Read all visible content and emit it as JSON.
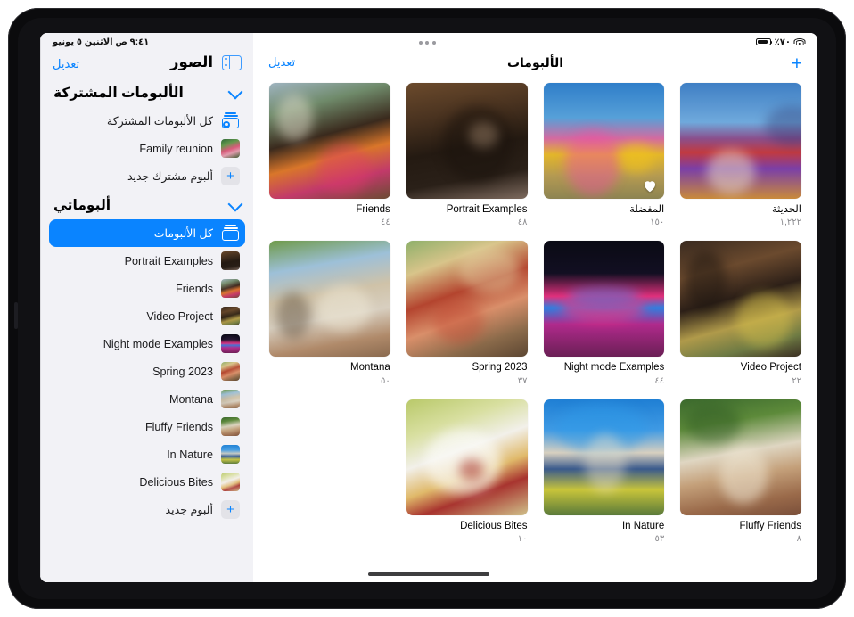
{
  "status_bar": {
    "battery_text": "٪٧٠",
    "battery_icon": "battery-icon",
    "wifi_icon": "wifi-icon",
    "time_and_date": "٩:٤١ ص   الاثنين ٥ يونيو"
  },
  "multitask": {
    "icon": "multitask-dots-icon"
  },
  "sidebar": {
    "title": "الصور",
    "edit_label": "تعديل",
    "toggle_icon": "sidebar-toggle-icon",
    "sections": [
      {
        "title": "الألبومات المشتركة",
        "chevron_icon": "chevron-down-icon",
        "items": [
          {
            "label": "كل الألبومات المشتركة",
            "icon": "shared-albums-icon",
            "type": "glyph",
            "selected": false
          },
          {
            "label": "Family reunion",
            "icon": "album-thumbnail",
            "type": "thumb",
            "thumb": "family-reunion",
            "selected": false
          },
          {
            "label": "ألبوم مشترك جديد",
            "icon": "plus-icon",
            "type": "plus",
            "selected": false
          }
        ]
      },
      {
        "title": "ألبوماتي",
        "chevron_icon": "chevron-down-icon",
        "items": [
          {
            "label": "كل الألبومات",
            "icon": "albums-icon",
            "type": "glyph",
            "selected": true
          },
          {
            "label": "Portrait Examples",
            "icon": "album-thumbnail",
            "type": "thumb",
            "thumb": "portrait",
            "selected": false
          },
          {
            "label": "Friends",
            "icon": "album-thumbnail",
            "type": "thumb",
            "thumb": "friends",
            "selected": false
          },
          {
            "label": "Video Project",
            "icon": "album-thumbnail",
            "type": "thumb",
            "thumb": "video",
            "selected": false
          },
          {
            "label": "Night mode Examples",
            "icon": "album-thumbnail",
            "type": "thumb",
            "thumb": "night",
            "selected": false
          },
          {
            "label": "Spring 2023",
            "icon": "album-thumbnail",
            "type": "thumb",
            "thumb": "spring",
            "selected": false
          },
          {
            "label": "Montana",
            "icon": "album-thumbnail",
            "type": "thumb",
            "thumb": "montana",
            "selected": false
          },
          {
            "label": "Fluffy Friends",
            "icon": "album-thumbnail",
            "type": "thumb",
            "thumb": "fluffy",
            "selected": false
          },
          {
            "label": "In Nature",
            "icon": "album-thumbnail",
            "type": "thumb",
            "thumb": "nature",
            "selected": false
          },
          {
            "label": "Delicious Bites",
            "icon": "album-thumbnail",
            "type": "thumb",
            "thumb": "bites",
            "selected": false
          },
          {
            "label": "ألبوم جديد",
            "icon": "plus-icon",
            "type": "plus",
            "selected": false
          }
        ]
      }
    ]
  },
  "main": {
    "edit_label": "تعديل",
    "title": "الألبومات",
    "add_icon": "plus-icon",
    "albums": [
      {
        "name": "الحديثة",
        "count": "١,٢٢٢",
        "thumb": "recents",
        "rtl": true,
        "favorite": false
      },
      {
        "name": "المفضلة",
        "count": "١٥٠",
        "thumb": "favorites",
        "rtl": true,
        "favorite": true
      },
      {
        "name": "Portrait Examples",
        "count": "٤٨",
        "thumb": "portrait",
        "rtl": false,
        "favorite": false
      },
      {
        "name": "Friends",
        "count": "٤٤",
        "thumb": "friends",
        "rtl": false,
        "favorite": false
      },
      {
        "name": "Video Project",
        "count": "٢٢",
        "thumb": "video",
        "rtl": false,
        "favorite": false
      },
      {
        "name": "Night mode Examples",
        "count": "٤٤",
        "thumb": "night",
        "rtl": false,
        "favorite": false
      },
      {
        "name": "Spring 2023",
        "count": "٣٧",
        "thumb": "spring",
        "rtl": false,
        "favorite": false
      },
      {
        "name": "Montana",
        "count": "٥٠",
        "thumb": "montana",
        "rtl": false,
        "favorite": false
      },
      {
        "name": "Fluffy Friends",
        "count": "٨",
        "thumb": "fluffy",
        "rtl": false,
        "favorite": false
      },
      {
        "name": "In Nature",
        "count": "٥٣",
        "thumb": "nature",
        "rtl": false,
        "favorite": false
      },
      {
        "name": "Delicious Bites",
        "count": "١٠",
        "thumb": "bites",
        "rtl": false,
        "favorite": false
      }
    ]
  },
  "colors": {
    "accent": "#0a84ff",
    "sidebar_bg": "#f2f2f6",
    "main_bg": "#ffffff",
    "secondary_text": "#8a8a8e"
  }
}
